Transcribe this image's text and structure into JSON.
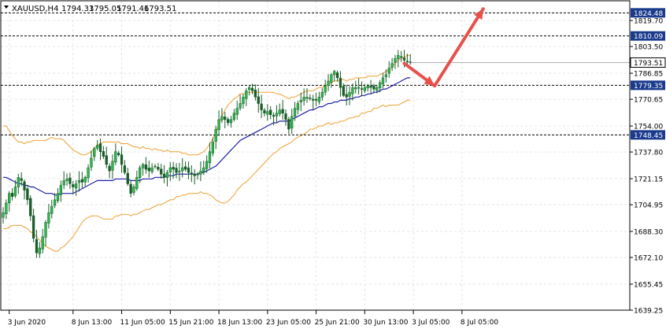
{
  "header": {
    "symbol": "XAUUSD,H4",
    "open": "1794.33",
    "high": "1795.05",
    "low": "1791.46",
    "close": "1793.51"
  },
  "chart_data": {
    "type": "candlestick",
    "ylim": [
      1639.25,
      1832
    ],
    "y_ticks": [
      "1819.70",
      "1803.50",
      "1786.85",
      "1770.65",
      "1754.00",
      "1737.80",
      "1721.15",
      "1704.95",
      "1688.30",
      "1672.10",
      "1655.45",
      "1639.25"
    ],
    "x_ticks": [
      {
        "label": "3 Jun 2020",
        "index": 2
      },
      {
        "label": "8 Jun 13:00",
        "index": 23
      },
      {
        "label": "11 Jun 05:00",
        "index": 39
      },
      {
        "label": "15 Jun 21:00",
        "index": 55
      },
      {
        "label": "18 Jun 13:00",
        "index": 71
      },
      {
        "label": "23 Jun 05:00",
        "index": 87
      },
      {
        "label": "25 Jun 21:00",
        "index": 103
      },
      {
        "label": "30 Jun 13:00",
        "index": 119
      },
      {
        "label": "3 Jul 05:00",
        "index": 135
      },
      {
        "label": "8 Jul 05:00",
        "index": 151
      }
    ],
    "levels": [
      {
        "value": 1824.48,
        "label": "1824.48"
      },
      {
        "value": 1810.09,
        "label": "1810.09"
      },
      {
        "value": 1779.35,
        "label": "1779.35"
      },
      {
        "value": 1748.45,
        "label": "1748.45"
      }
    ],
    "current_price": {
      "value": 1793.51,
      "label": "1793.51"
    },
    "close_path": [
      1700,
      1706,
      1712,
      1710,
      1716,
      1722,
      1720,
      1714,
      1708,
      1698,
      1684,
      1675,
      1678,
      1685,
      1694,
      1700,
      1704,
      1708,
      1712,
      1717,
      1720,
      1721,
      1718,
      1716,
      1718,
      1720,
      1719,
      1722,
      1728,
      1734,
      1740,
      1742,
      1738,
      1735,
      1730,
      1726,
      1732,
      1738,
      1736,
      1730,
      1725,
      1718,
      1712,
      1716,
      1722,
      1728,
      1730,
      1727,
      1726,
      1728,
      1729,
      1727,
      1724,
      1722,
      1725,
      1728,
      1727,
      1725,
      1726,
      1728,
      1727,
      1725,
      1724,
      1723,
      1724,
      1726,
      1728,
      1732,
      1738,
      1744,
      1752,
      1758,
      1760,
      1758,
      1756,
      1758,
      1762,
      1765,
      1768,
      1772,
      1776,
      1778,
      1776,
      1772,
      1768,
      1764,
      1762,
      1763,
      1761,
      1760,
      1762,
      1764,
      1762,
      1758,
      1752,
      1760,
      1765,
      1768,
      1770,
      1772,
      1772,
      1771,
      1770,
      1770,
      1772,
      1775,
      1779,
      1782,
      1786,
      1788,
      1784,
      1778,
      1773,
      1772,
      1775,
      1778,
      1778,
      1778,
      1777,
      1778,
      1779,
      1778,
      1777,
      1778,
      1781,
      1784,
      1786,
      1790,
      1793,
      1796,
      1798,
      1797,
      1795,
      1794,
      1793.51
    ],
    "sma_path": [
      1722,
      1722,
      1721,
      1720,
      1719,
      1718,
      1718,
      1717,
      1717,
      1716,
      1716,
      1715,
      1714,
      1713,
      1712,
      1712,
      1712,
      1711,
      1711,
      1712,
      1712,
      1712,
      1712,
      1712,
      1713,
      1714,
      1715,
      1716,
      1717,
      1718,
      1719,
      1720,
      1720,
      1720,
      1720,
      1720,
      1720,
      1721,
      1721,
      1721,
      1721,
      1721,
      1720,
      1720,
      1720,
      1720,
      1721,
      1721,
      1721,
      1721,
      1722,
      1722,
      1722,
      1722,
      1723,
      1723,
      1723,
      1724,
      1724,
      1724,
      1724,
      1724,
      1724,
      1724,
      1724,
      1725,
      1725,
      1726,
      1727,
      1728,
      1729,
      1731,
      1733,
      1735,
      1737,
      1739,
      1741,
      1743,
      1745,
      1746,
      1747,
      1748,
      1749,
      1750,
      1751,
      1752,
      1753,
      1754,
      1755,
      1756,
      1756,
      1757,
      1757,
      1757,
      1757,
      1758,
      1759,
      1760,
      1761,
      1762,
      1763,
      1764,
      1764,
      1765,
      1766,
      1766,
      1767,
      1768,
      1768,
      1769,
      1769,
      1770,
      1770,
      1770,
      1771,
      1771,
      1772,
      1772,
      1773,
      1773,
      1774,
      1774,
      1775,
      1775,
      1776,
      1777,
      1777,
      1778,
      1779,
      1780,
      1781,
      1782,
      1783,
      1784,
      1784
    ],
    "band_width": [
      32,
      32,
      30,
      28,
      27,
      26,
      26,
      26,
      27,
      28,
      29,
      30,
      31,
      32,
      33,
      34,
      35,
      35,
      35,
      34,
      33,
      31,
      29,
      27,
      25,
      23,
      21,
      20,
      20,
      20,
      21,
      22,
      23,
      24,
      24,
      24,
      24,
      23,
      23,
      22,
      22,
      22,
      22,
      21,
      21,
      20,
      20,
      19,
      19,
      18,
      18,
      17,
      17,
      16,
      16,
      15,
      15,
      14,
      14,
      13,
      13,
      12,
      12,
      12,
      12,
      12,
      13,
      14,
      16,
      18,
      21,
      24,
      27,
      29,
      30,
      30,
      30,
      29,
      29,
      28,
      28,
      27,
      26,
      25,
      24,
      23,
      22,
      21,
      20,
      19,
      18,
      17,
      16,
      15,
      14,
      14,
      13,
      13,
      13,
      13,
      13,
      12,
      12,
      12,
      12,
      12,
      12,
      12,
      13,
      13,
      13,
      13,
      13,
      12,
      12,
      12,
      12,
      12,
      11,
      11,
      11,
      11,
      10,
      10,
      10,
      10,
      11,
      11,
      12,
      13,
      14,
      14,
      14,
      14,
      14
    ],
    "annotation_arrows": [
      {
        "from": [
          1793,
          132
        ],
        "to": [
          1779,
          142
        ],
        "color": "#e8504a"
      },
      {
        "from": [
          1779,
          142
        ],
        "to": [
          1827,
          158
        ],
        "color": "#e8504a"
      }
    ]
  }
}
